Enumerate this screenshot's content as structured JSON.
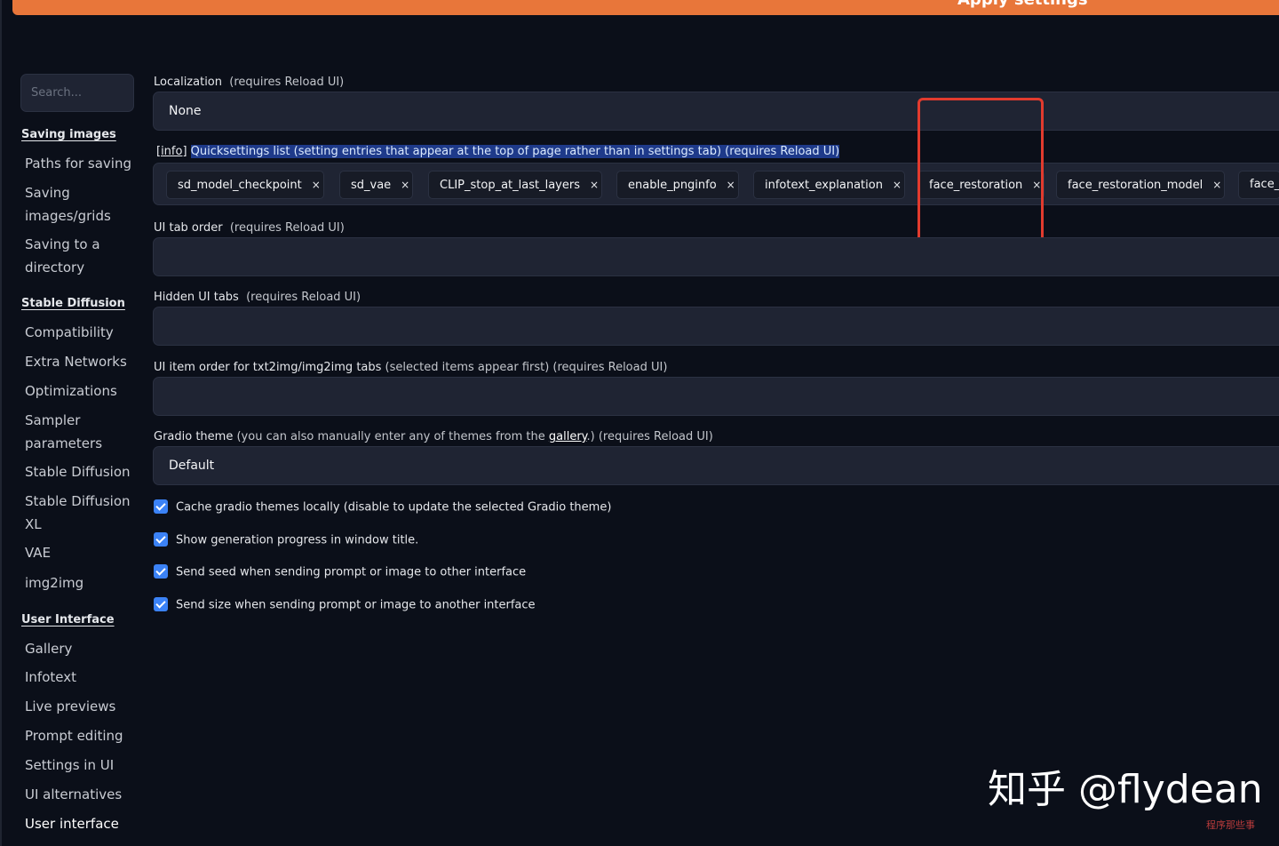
{
  "top_bar": {
    "label": "Apply settings"
  },
  "sidebar": {
    "search_placeholder": "Search...",
    "sections": [
      {
        "title": "Saving images",
        "items": [
          "Paths for saving",
          "Saving images/grids",
          "Saving to a directory"
        ]
      },
      {
        "title": "Stable Diffusion",
        "items": [
          "Compatibility",
          "Extra Networks",
          "Optimizations",
          "Sampler parameters",
          "Stable Diffusion",
          "Stable Diffusion XL",
          "VAE",
          "img2img"
        ]
      },
      {
        "title": "User Interface",
        "items": [
          "Gallery",
          "Infotext",
          "Live previews",
          "Prompt editing",
          "Settings in UI",
          "UI alternatives",
          "User interface"
        ]
      }
    ]
  },
  "main": {
    "localization": {
      "label": "Localization",
      "note": "(requires Reload UI)",
      "value": "None"
    },
    "quicksettings": {
      "info": "[info]",
      "label": "Quicksettings list",
      "note": "(setting entries that appear at the top of page rather than in settings tab) (requires Reload UI)",
      "chips": [
        "sd_model_checkpoint",
        "sd_vae",
        "CLIP_stop_at_last_layers",
        "enable_pnginfo",
        "infotext_explanation",
        "face_restoration",
        "face_restoration_model",
        "face_"
      ],
      "remove_glyph": "×"
    },
    "ui_tab_order": {
      "label": "UI tab order",
      "note": "(requires Reload UI)"
    },
    "hidden_ui_tabs": {
      "label": "Hidden UI tabs",
      "note": "(requires Reload UI)"
    },
    "ui_item_order": {
      "label": "UI item order for txt2img/img2img tabs",
      "note": "(selected items appear first) (requires Reload UI)"
    },
    "gradio_theme": {
      "label": "Gradio theme",
      "note_pre": "(you can also manually enter any of themes from the",
      "link": "gallery",
      "note_post": ".) (requires Reload UI)",
      "value": "Default"
    },
    "checkboxes": [
      {
        "label": "Cache gradio themes locally",
        "note": "(disable to update the selected Gradio theme)",
        "checked": true
      },
      {
        "label": "Show generation progress in window title.",
        "note": "",
        "checked": true
      },
      {
        "label": "Send seed when sending prompt or image to other interface",
        "note": "",
        "checked": true
      },
      {
        "label": "Send size when sending prompt or image to another interface",
        "note": "",
        "checked": true
      }
    ]
  },
  "watermark": {
    "text": "知乎 @flydean",
    "small": "程序那些事"
  },
  "colors": {
    "accent": "#e8763a",
    "background": "#0b0f19",
    "checkbox": "#3b82f6",
    "highlight_box": "#e23b2e"
  }
}
